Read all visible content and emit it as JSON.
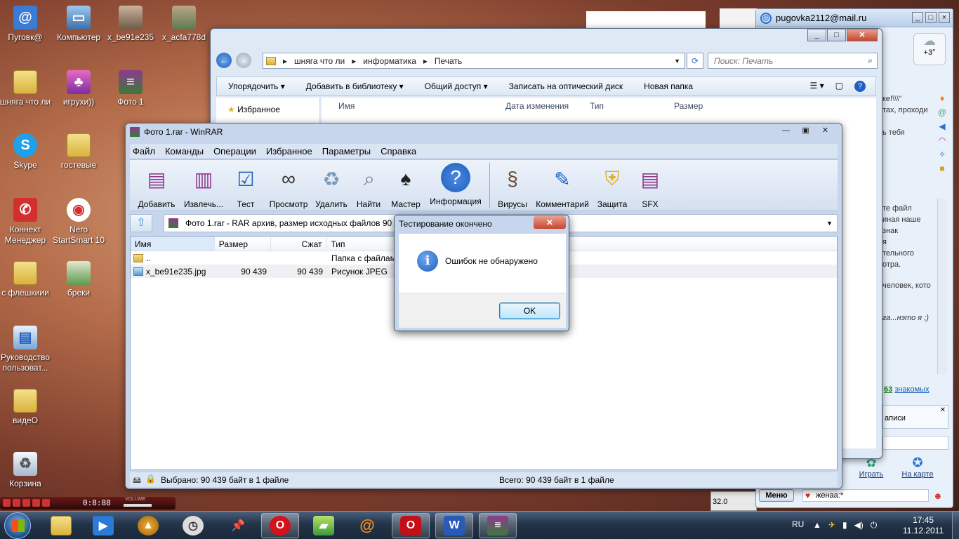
{
  "desktop": {
    "icons": [
      {
        "label": "Пуговк@"
      },
      {
        "label": "Компьютер"
      },
      {
        "label": "x_be91e235"
      },
      {
        "label": "x_acfa778d"
      },
      {
        "label": "шняга что ли"
      },
      {
        "label": "игрухи))"
      },
      {
        "label": "Фото 1"
      },
      {
        "label": "Skype"
      },
      {
        "label": "гостевые"
      },
      {
        "label": "Коннект Менеджер"
      },
      {
        "label": "Nero StartSmart 10"
      },
      {
        "label": "с флешкиии"
      },
      {
        "label": "бреки"
      },
      {
        "label": "Руководство пользоват..."
      },
      {
        "label": "видеО"
      },
      {
        "label": "Корзина"
      }
    ],
    "player_time": "0:8:88",
    "player_volume_label": "VOLUME",
    "gadget_value": "32.0"
  },
  "mail_agent": {
    "account": "pugovka2112@mail.ru",
    "weather": "+3°",
    "snippet_1": "ке!\\\\\\\"",
    "snippet_2": "тах, проходи",
    "snippet_3": "ь тебя",
    "snippet_4": "те файл",
    "snippet_5": "иная наше знак",
    "snippet_6": "я",
    "snippet_7": "тельного",
    "snippet_8": "отра.",
    "snippet_9": "человек, кото",
    "snippet_10": "га...нэто я ;)",
    "acquaintances_count": "63",
    "acquaintances_label": "знакомых",
    "notes_label": "аписи",
    "play_label": "Играть",
    "map_label": "На карте",
    "menu_label": "Меню",
    "status_text": "женаа:*"
  },
  "explorer": {
    "breadcrumb": [
      "шняга что ли",
      "информатика",
      "Печать"
    ],
    "search_placeholder": "Поиск: Печать",
    "toolbar": [
      "Упорядочить",
      "Добавить в библиотеку",
      "Общий доступ",
      "Записать на оптический диск",
      "Новая папка"
    ],
    "nav_favorites": "Избранное",
    "columns": [
      "Имя",
      "Дата изменения",
      "Тип",
      "Размер"
    ]
  },
  "winrar": {
    "title": "Фото 1.rar - WinRAR",
    "menu": [
      "Файл",
      "Команды",
      "Операции",
      "Избранное",
      "Параметры",
      "Справка"
    ],
    "tools": [
      "Добавить",
      "Извлечь...",
      "Тест",
      "Просмотр",
      "Удалить",
      "Найти",
      "Мастер",
      "Информация",
      "Вирусы",
      "Комментарий",
      "Защита",
      "SFX"
    ],
    "path": "Фото 1.rar - RAR архив, размер исходных файлов 90 439",
    "columns": [
      "Имя",
      "Размер",
      "Сжат",
      "Тип"
    ],
    "rows": [
      {
        "name": "..",
        "size": "",
        "packed": "",
        "type": "Папка с файлам"
      },
      {
        "name": "x_be91e235.jpg",
        "size": "90 439",
        "packed": "90 439",
        "type": "Рисунок JPEG"
      }
    ],
    "status_selected": "Выбрано: 90 439 байт в 1 файле",
    "status_total": "Всего: 90 439 байт в 1 файле"
  },
  "dialog": {
    "title": "Тестирование окончено",
    "message": "Ошибок не обнаружено",
    "ok": "OK"
  },
  "taskbar": {
    "language": "RU",
    "time": "17:45",
    "date": "11.12.2011"
  },
  "colors": {
    "titlebar": "#c9d9ee",
    "close_red": "#c6462e",
    "taskbar": "#233449",
    "info_blue": "#1f5fbf"
  }
}
